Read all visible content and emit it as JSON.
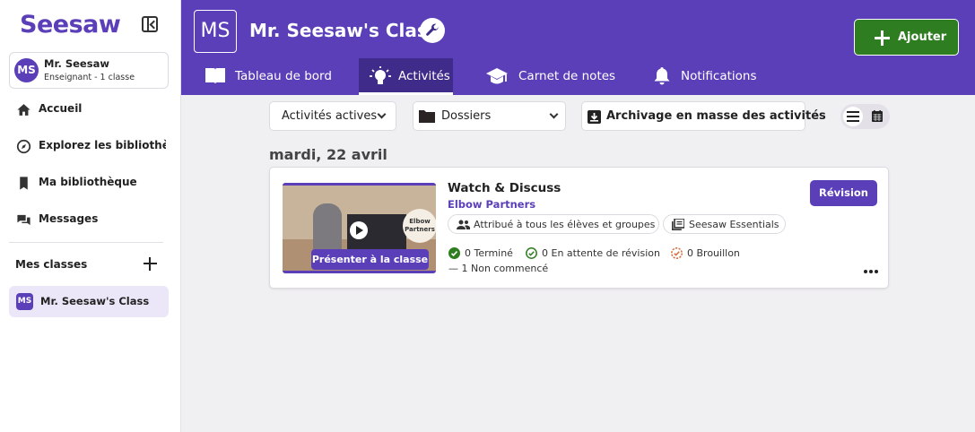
{
  "app": {
    "logo": "Seesaw"
  },
  "user": {
    "initials": "MS",
    "name": "Mr. Seesaw",
    "role": "Enseignant - 1 classe"
  },
  "sidebar": {
    "items": [
      {
        "label": "Accueil",
        "icon": "home-icon"
      },
      {
        "label": "Explorez les bibliothèques",
        "icon": "compass-icon"
      },
      {
        "label": "Ma bibliothèque",
        "icon": "bookmark-icon"
      },
      {
        "label": "Messages",
        "icon": "chat-icon"
      }
    ],
    "classes_label": "Mes classes",
    "classes": [
      {
        "initials": "MS",
        "label": "Mr. Seesaw's Class"
      }
    ]
  },
  "header": {
    "class_initials": "MS",
    "class_title": "Mr. Seesaw's Class",
    "add_label": "Ajouter",
    "tabs": [
      {
        "label": "Tableau de bord",
        "icon": "book-icon",
        "active": false
      },
      {
        "label": "Activités",
        "icon": "lightbulb-icon",
        "active": true
      },
      {
        "label": "Carnet de notes",
        "icon": "graduation-cap-icon",
        "active": false
      },
      {
        "label": "Notifications",
        "icon": "bell-icon",
        "active": false
      }
    ]
  },
  "toolbar": {
    "filter": "Activités actives",
    "folders": "Dossiers",
    "archive": "Archivage en masse des activités"
  },
  "date_heading": "mardi, 22 avril",
  "activity": {
    "title": "Watch & Discuss",
    "subtitle": "Elbow Partners",
    "thumbnail_text": "Elbow Partners",
    "present_label": "Présenter à la classe",
    "assigned": "Attribué à tous les élèves et groupes",
    "collection": "Seesaw Essentials",
    "stats": {
      "done": "0 Terminé",
      "pending": "0 En attente de révision",
      "draft": "0 Brouillon",
      "not_started": "— 1 Non commencé"
    },
    "review_label": "Révision"
  },
  "colors": {
    "brand": "#5b3fb8",
    "add_button": "#2e7d20",
    "done": "#2e7d20",
    "draft": "#d86a3a"
  }
}
